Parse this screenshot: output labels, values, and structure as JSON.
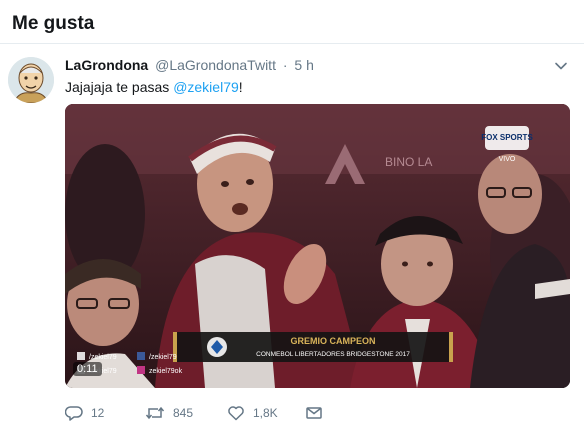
{
  "header": {
    "title": "Me gusta"
  },
  "tweet": {
    "display_name": "LaGrondona",
    "screen_name": "@LaGrondonaTwitt",
    "separator": "·",
    "time": "5 h",
    "text_prefix": "Jajajaja te pasas ",
    "mention": "@zekiel79",
    "text_suffix": "!",
    "avatar_icon": "caricature-avatar"
  },
  "media": {
    "timer": "0:11",
    "broadcaster_badge": "FOX SPORTS",
    "broadcaster_sub": "VIVO",
    "banner_title": "GREMIO CAMPEON",
    "banner_subtitle": "CONMEBOL LIBERTADORES BRIDGESTONE 2017",
    "watermarks": [
      "/zekiel79",
      "/zekiel79",
      "/zekiel79",
      "zekiel79ok"
    ],
    "bg_text": "BINO LA"
  },
  "actions": {
    "reply_count": "12",
    "retweet_count": "845",
    "like_count": "1,8K"
  },
  "colors": {
    "accent": "#1da1f2",
    "muted": "#657786",
    "border": "#e6ecf0",
    "media_bg": "#3a2024"
  }
}
